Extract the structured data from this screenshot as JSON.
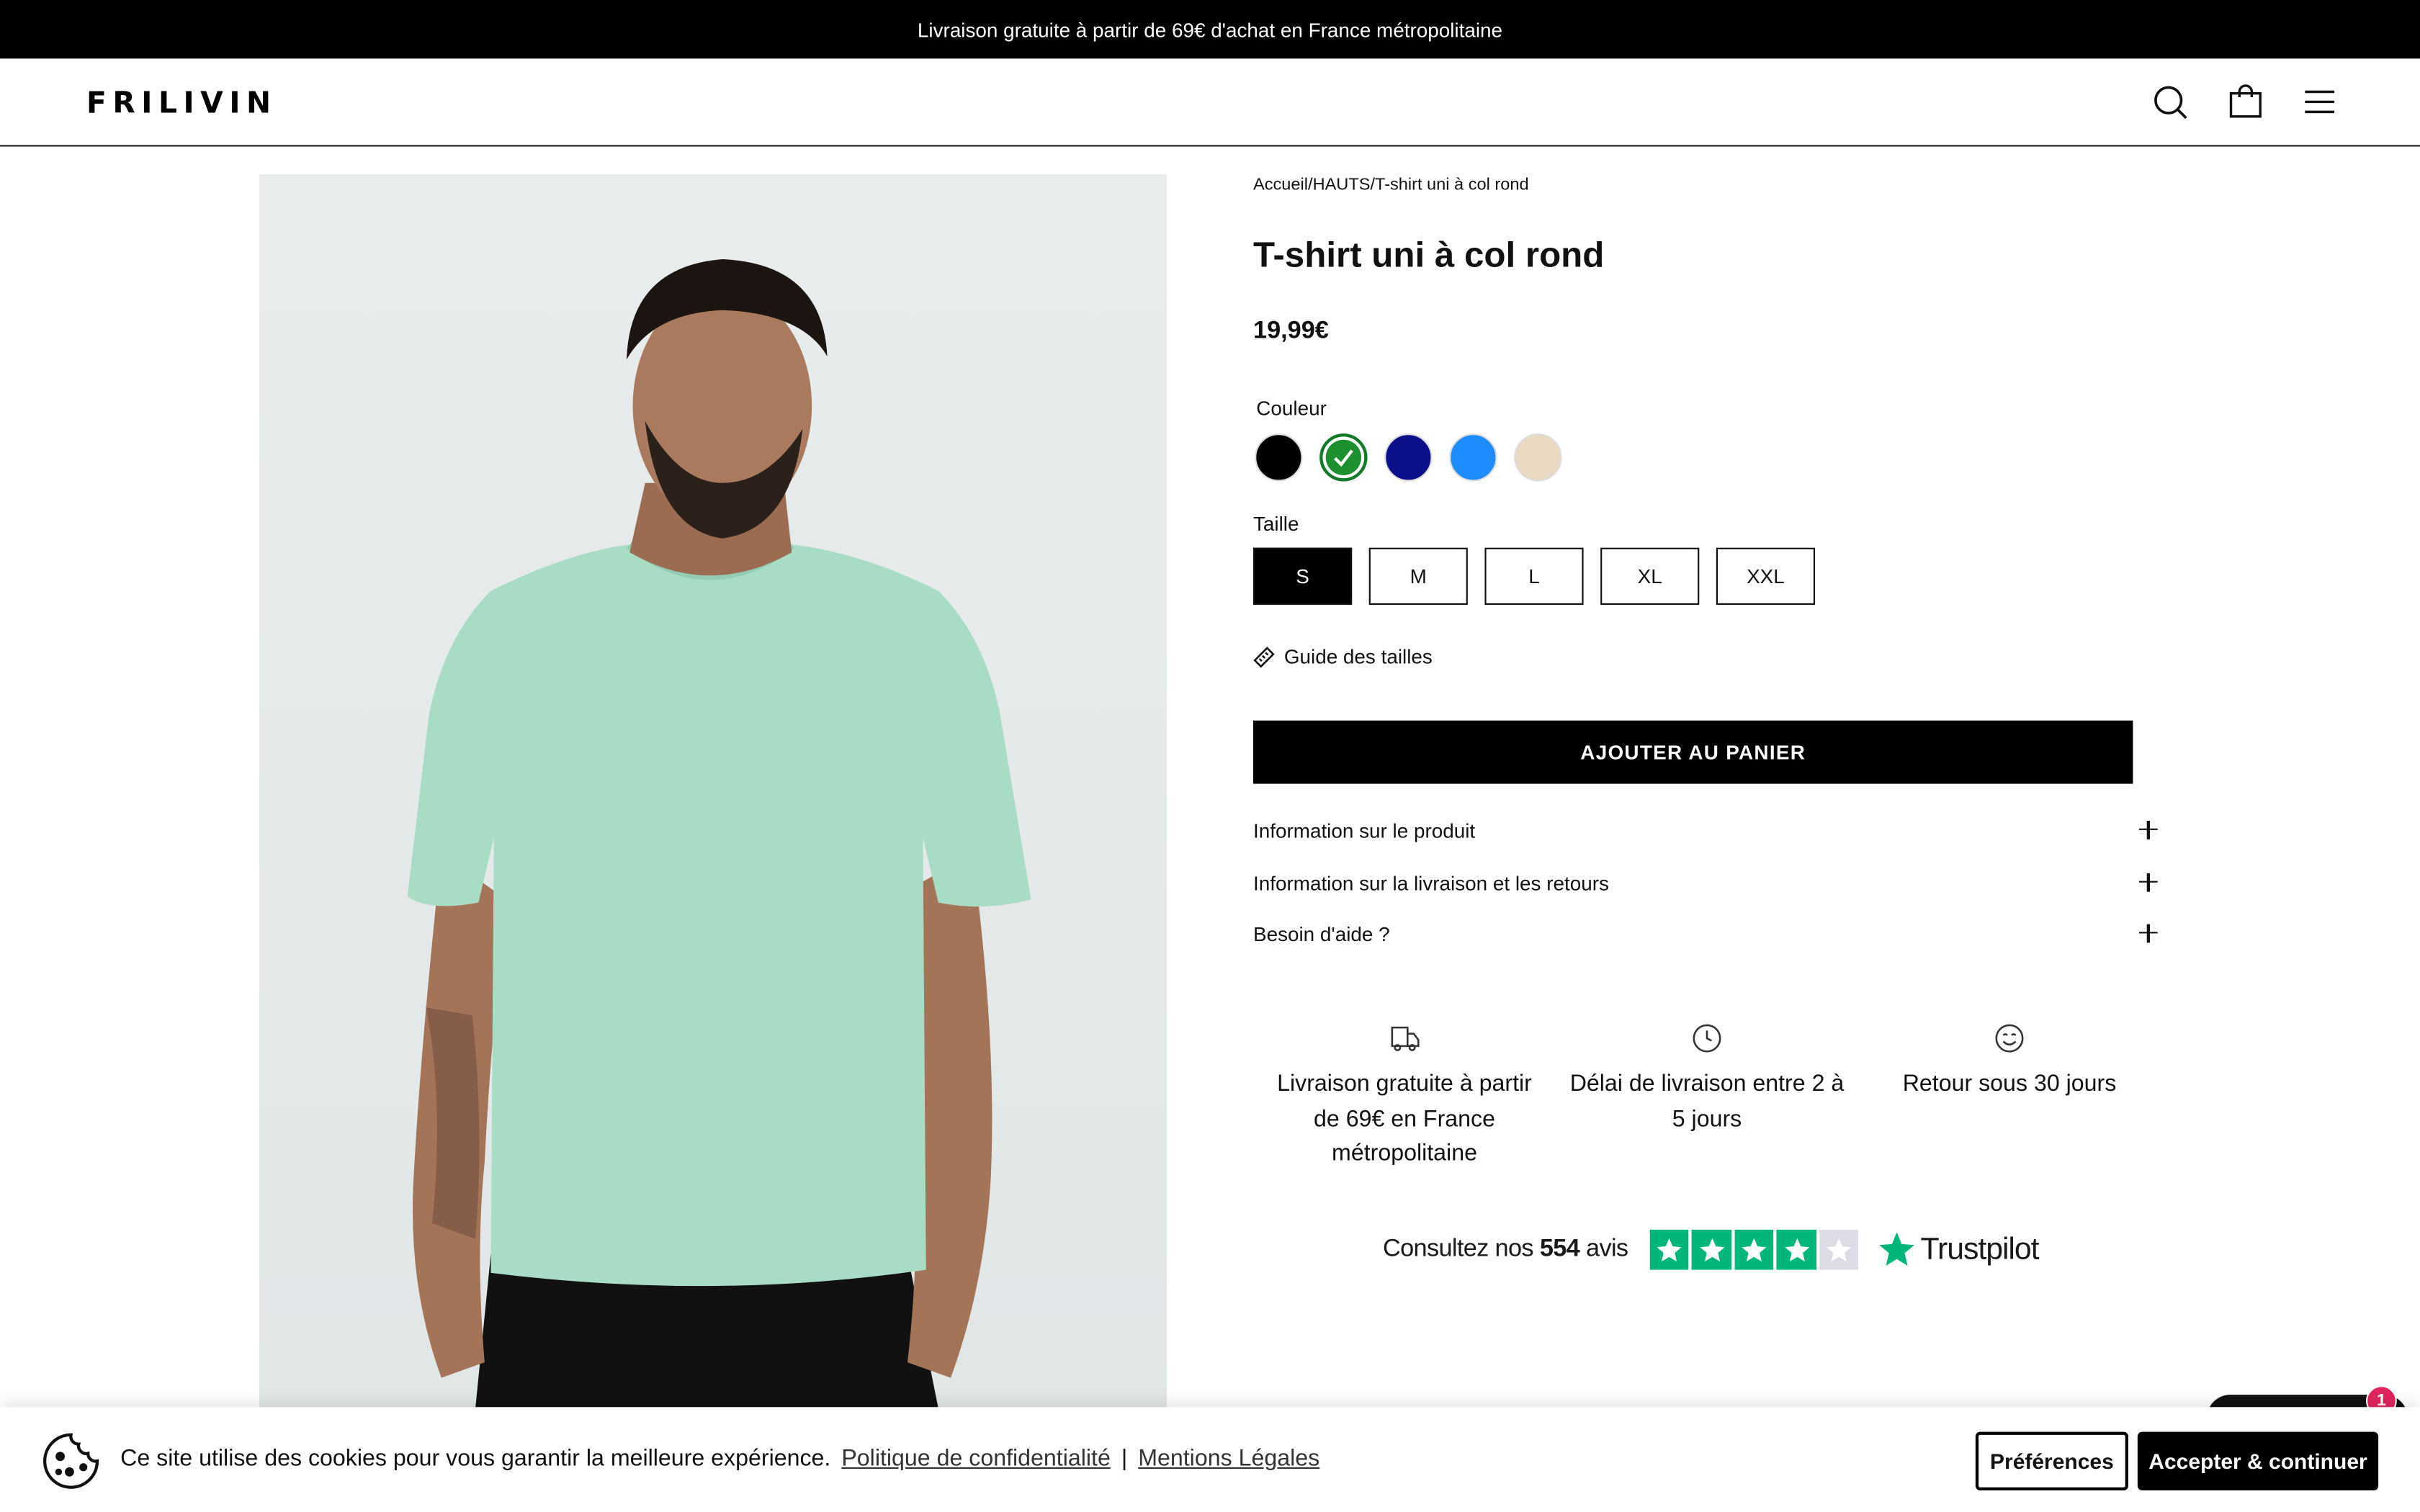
{
  "announcement": "Livraison gratuite à partir de 69€ d'achat en France métropolitaine",
  "header": {
    "logo": "FRILIVIN",
    "icons": [
      "search-icon",
      "shopping-bag-icon",
      "menu-icon"
    ]
  },
  "breadcrumb": {
    "home": "Accueil",
    "sep1": "/",
    "category": "HAUTS",
    "sep2": "/",
    "current": "T-shirt uni à col rond"
  },
  "product": {
    "title": "T-shirt uni à col rond",
    "price": "19,99€",
    "color_label": "Couleur",
    "colors": [
      {
        "name": "black",
        "hex": "#000000",
        "selected": false
      },
      {
        "name": "green",
        "hex": "#1e8f2e",
        "selected": true
      },
      {
        "name": "navy",
        "hex": "#0b0f8a",
        "selected": false
      },
      {
        "name": "blue",
        "hex": "#1e8cff",
        "selected": false
      },
      {
        "name": "beige",
        "hex": "#ead9c2",
        "selected": false
      }
    ],
    "size_label": "Taille",
    "sizes": [
      "S",
      "M",
      "L",
      "XL",
      "XXL"
    ],
    "selected_size": "S",
    "size_guide": "Guide des tailles",
    "add_to_cart": "AJOUTER AU PANIER"
  },
  "accordions": [
    "Information sur le produit",
    "Information sur la livraison et les retours",
    "Besoin d'aide ?"
  ],
  "features": [
    {
      "icon": "truck-icon",
      "text": "Livraison gratuite à partir de 69€ en France métropolitaine"
    },
    {
      "icon": "clock-icon",
      "text": "Délai de livraison entre 2 à 5 jours"
    },
    {
      "icon": "smile-icon",
      "text": "Retour sous 30 jours"
    }
  ],
  "trustpilot": {
    "prefix": "Consultez nos",
    "count": "554",
    "suffix": "avis",
    "brand": "Trustpilot",
    "stars": 4,
    "color": "#00b67a"
  },
  "chat": {
    "badge": "1"
  },
  "cookie_banner": {
    "text": "Ce site utilise des cookies pour vous garantir la meilleure expérience.",
    "privacy_link": "Politique de confidentialité",
    "separator": "|",
    "legal_link": "Mentions Légales",
    "preferences": "Préférences",
    "accept": "Accepter & continuer"
  }
}
